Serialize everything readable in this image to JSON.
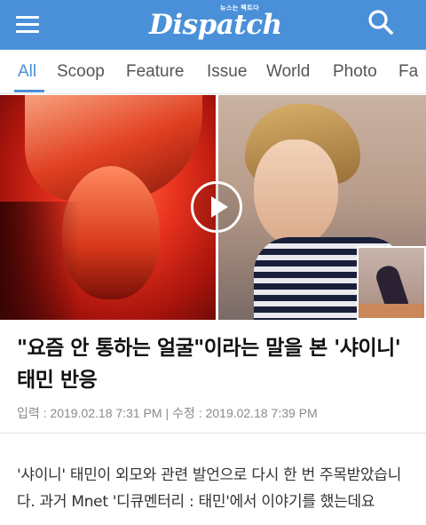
{
  "header": {
    "logo_word": "Dispatch",
    "logo_tagline": "뉴스는 팩트다",
    "menu_icon": "hamburger-menu-icon",
    "search_icon": "search-icon",
    "bg_color": "#4a90d9"
  },
  "nav": {
    "tabs": [
      {
        "label": "All",
        "active": true
      },
      {
        "label": "Scoop",
        "active": false
      },
      {
        "label": "Feature",
        "active": false
      },
      {
        "label": "Issue",
        "active": false
      },
      {
        "label": "World",
        "active": false
      },
      {
        "label": "Photo",
        "active": false
      },
      {
        "label": "Fa",
        "active": false
      }
    ],
    "accent_color": "#4a90d9"
  },
  "hero": {
    "play_icon": "play-icon"
  },
  "article": {
    "title": "\"요즘 안 통하는 얼굴\"이라는 말을 본 '샤이니' 태민 반응",
    "meta": {
      "input_label": "입력 : 2019.02.18 7:31 PM",
      "separator": "|",
      "edit_label": "수정 : 2019.02.18 7:39 PM"
    },
    "body": "'샤이니' 태민이 외모와 관련 발언으로 다시 한 번 주목받았습니다. 과거 Mnet '디큐멘터리 : 태민'에서 이야기를 했는데요"
  }
}
